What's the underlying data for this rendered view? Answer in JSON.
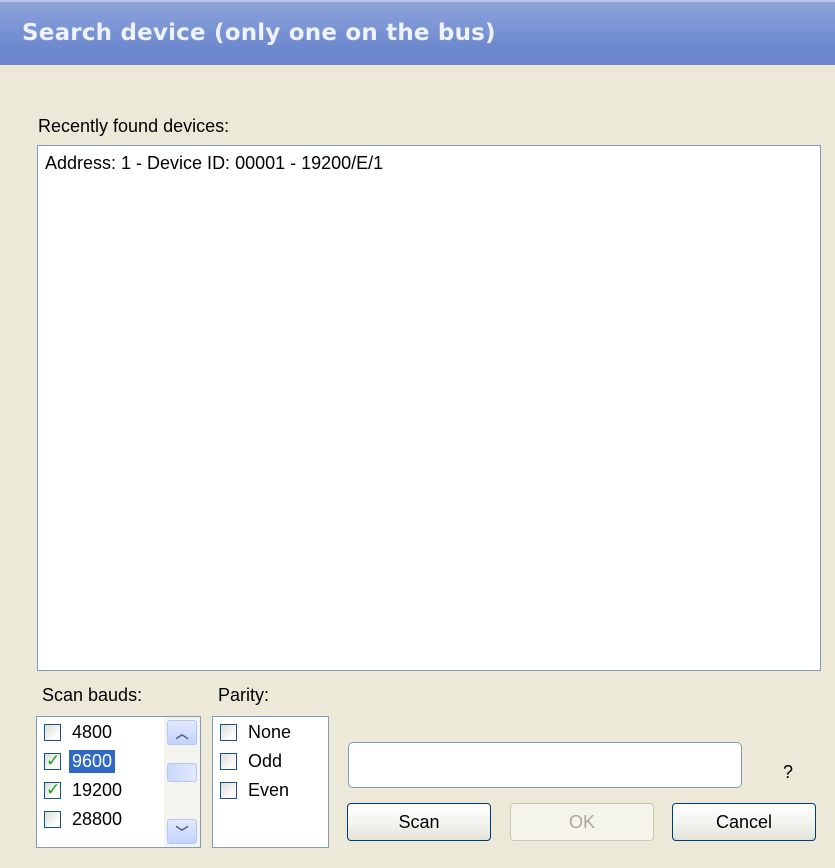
{
  "window": {
    "title": "Search device (only one on the bus)"
  },
  "devices": {
    "label": "Recently found devices:",
    "items": [
      "Address: 1 - Device ID: 00001 - 19200/E/1"
    ]
  },
  "bauds": {
    "label": "Scan bauds:",
    "items": [
      {
        "label": "4800",
        "checked": false,
        "selected": false
      },
      {
        "label": "9600",
        "checked": true,
        "selected": true
      },
      {
        "label": "19200",
        "checked": true,
        "selected": false
      },
      {
        "label": "28800",
        "checked": false,
        "selected": false
      }
    ]
  },
  "parity": {
    "label": "Parity:",
    "items": [
      {
        "label": "None",
        "checked": false
      },
      {
        "label": "Odd",
        "checked": false
      },
      {
        "label": "Even",
        "checked": false
      }
    ]
  },
  "status_field": {
    "value": ""
  },
  "help_label": "?",
  "buttons": {
    "scan": "Scan",
    "ok": "OK",
    "cancel": "Cancel"
  },
  "icons": {
    "scroll_up": "chevron-up-icon",
    "scroll_down": "chevron-down-icon",
    "check": "checkmark-icon"
  },
  "colors": {
    "titlebar": "#7e97d6",
    "dialog_bg": "#ece9d8",
    "selection": "#316ac5",
    "check": "#21a121"
  }
}
